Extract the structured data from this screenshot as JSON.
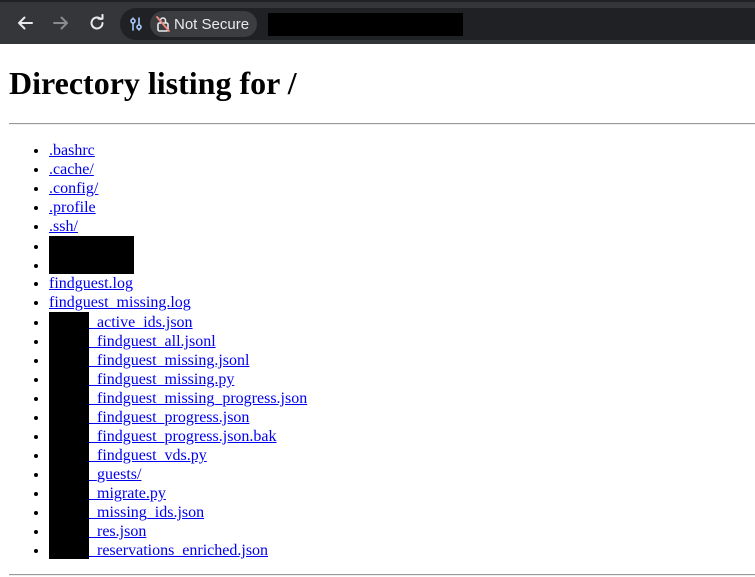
{
  "browser": {
    "security_label": "Not Secure"
  },
  "page": {
    "title": "Directory listing for /",
    "entries": [
      {
        "text": ".bashrc",
        "redacted_prefix": false,
        "fully_redacted": false
      },
      {
        "text": ".cache/",
        "redacted_prefix": false,
        "fully_redacted": false
      },
      {
        "text": ".config/",
        "redacted_prefix": false,
        "fully_redacted": false
      },
      {
        "text": ".profile",
        "redacted_prefix": false,
        "fully_redacted": false
      },
      {
        "text": ".ssh/",
        "redacted_prefix": false,
        "fully_redacted": false
      },
      {
        "text": "",
        "redacted_prefix": false,
        "fully_redacted": true
      },
      {
        "text": "",
        "redacted_prefix": false,
        "fully_redacted": true
      },
      {
        "text": "findguest.log",
        "redacted_prefix": false,
        "fully_redacted": false
      },
      {
        "text": "findguest_missing.log",
        "redacted_prefix": false,
        "fully_redacted": false
      },
      {
        "text": "_active_ids.json",
        "redacted_prefix": true,
        "fully_redacted": false
      },
      {
        "text": "_findguest_all.jsonl",
        "redacted_prefix": true,
        "fully_redacted": false
      },
      {
        "text": "_findguest_missing.jsonl",
        "redacted_prefix": true,
        "fully_redacted": false
      },
      {
        "text": "_findguest_missing.py",
        "redacted_prefix": true,
        "fully_redacted": false
      },
      {
        "text": "_findguest_missing_progress.json",
        "redacted_prefix": true,
        "fully_redacted": false
      },
      {
        "text": "_findguest_progress.json",
        "redacted_prefix": true,
        "fully_redacted": false
      },
      {
        "text": "_findguest_progress.json.bak",
        "redacted_prefix": true,
        "fully_redacted": false
      },
      {
        "text": "_findguest_vds.py",
        "redacted_prefix": true,
        "fully_redacted": false
      },
      {
        "text": "_guests/",
        "redacted_prefix": true,
        "fully_redacted": false
      },
      {
        "text": "_migrate.py",
        "redacted_prefix": true,
        "fully_redacted": false
      },
      {
        "text": "_missing_ids.json",
        "redacted_prefix": true,
        "fully_redacted": false
      },
      {
        "text": "_res.json",
        "redacted_prefix": true,
        "fully_redacted": false
      },
      {
        "text": "_reservations_enriched.json",
        "redacted_prefix": true,
        "fully_redacted": false
      }
    ]
  }
}
